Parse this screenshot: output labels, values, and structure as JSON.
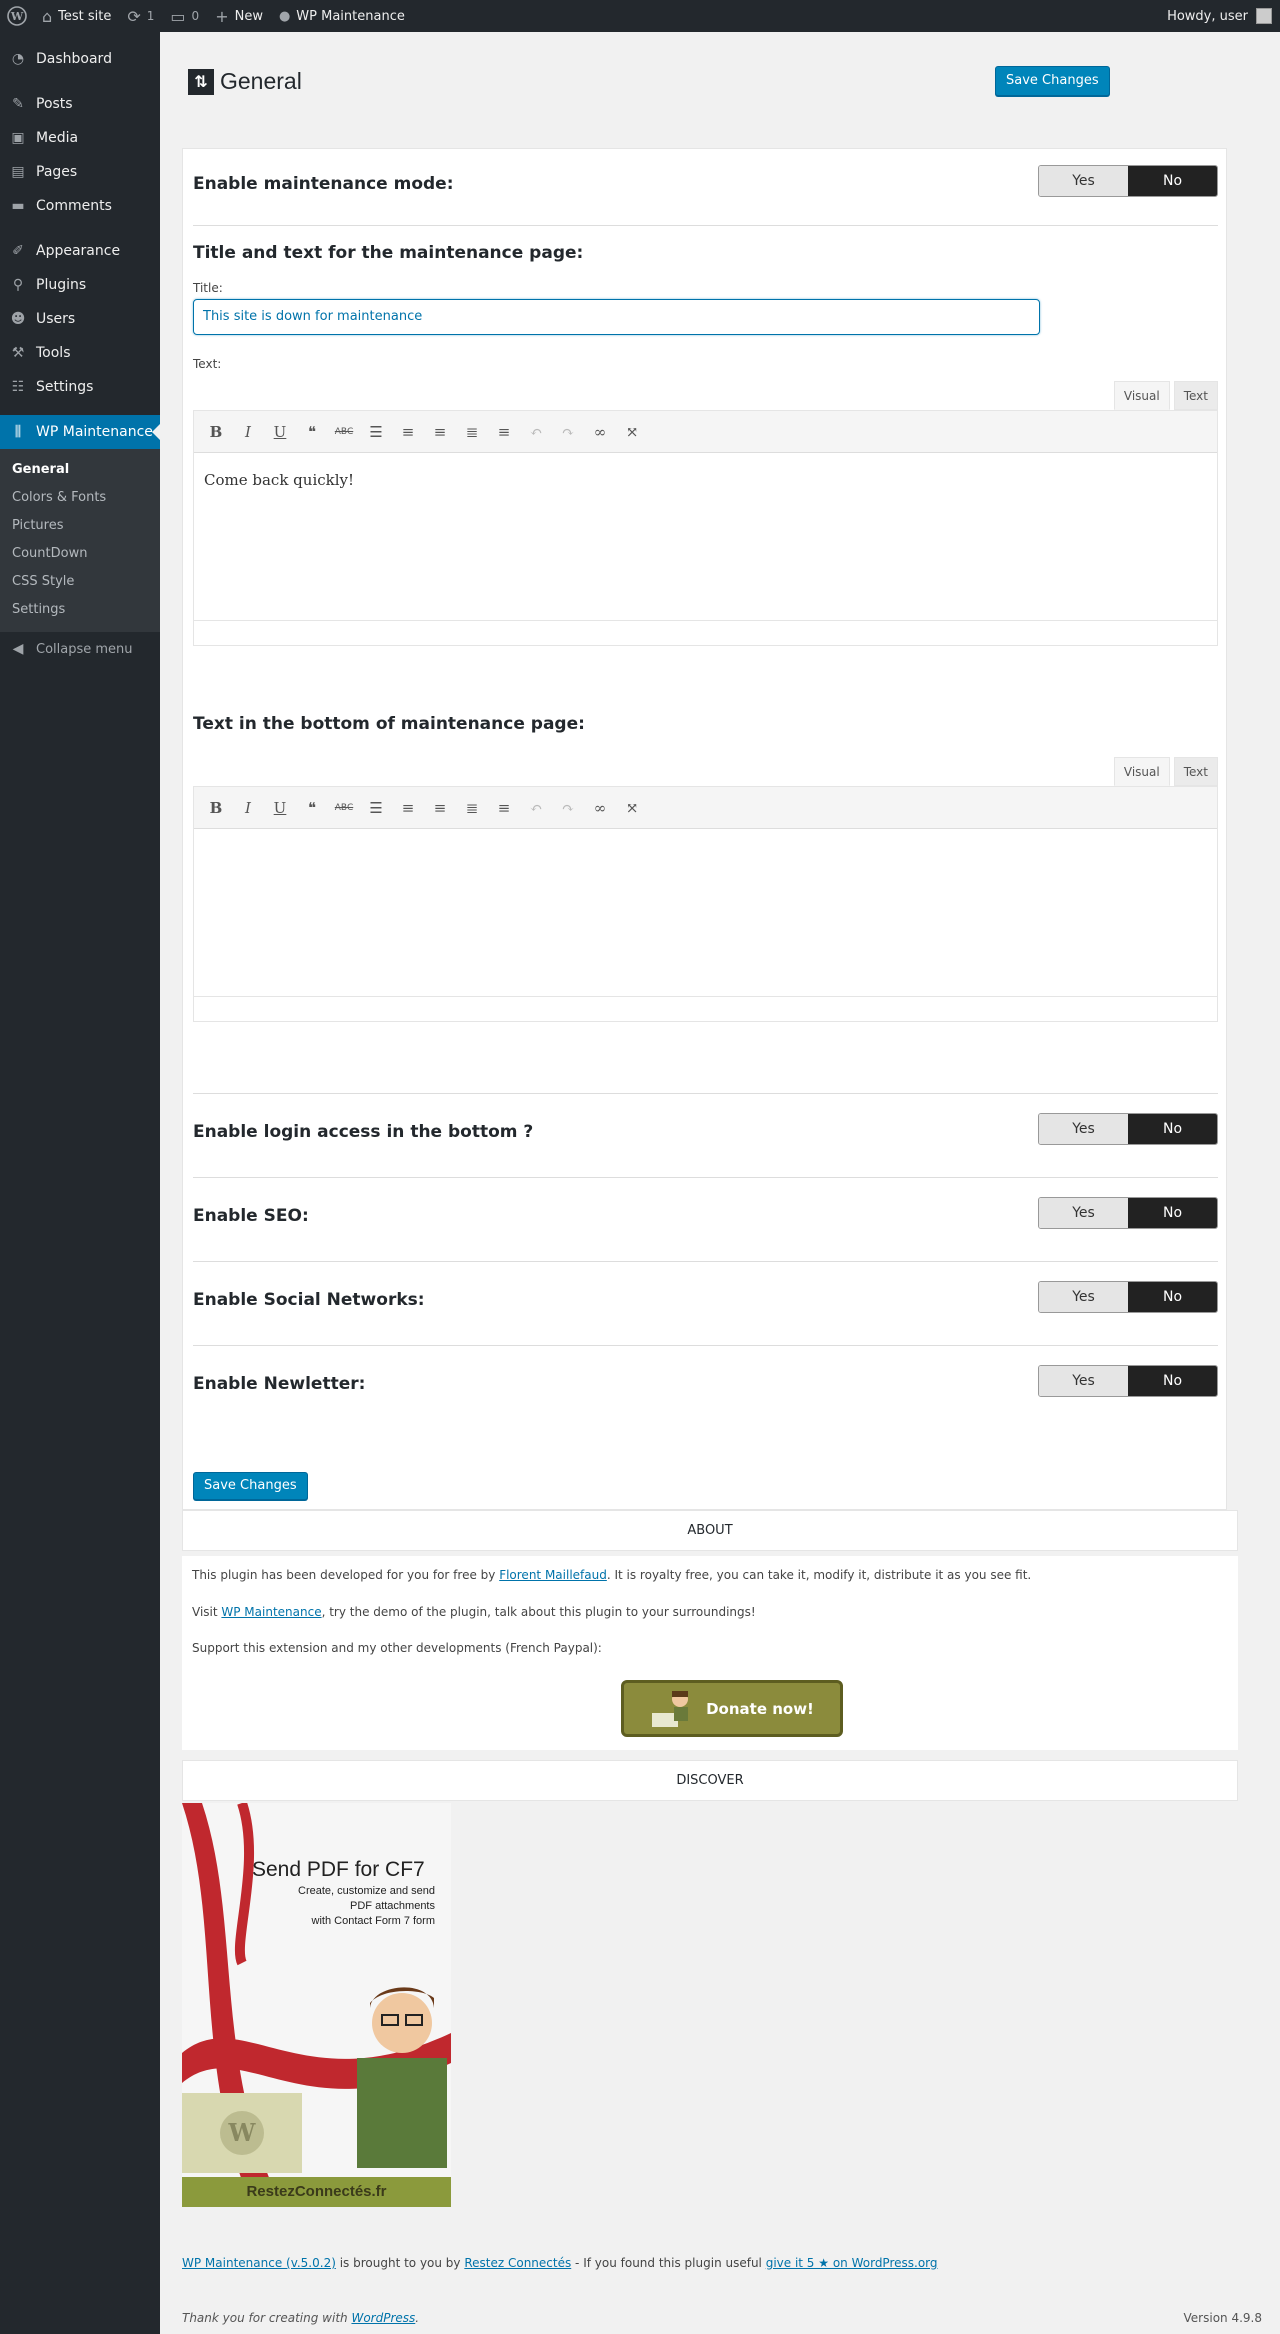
{
  "adminbar": {
    "site_name": "Test site",
    "updates_count": "1",
    "comments_count": "0",
    "new_label": "New",
    "plugin_label": "WP Maintenance",
    "howdy": "Howdy, user"
  },
  "sidebar": {
    "items": [
      {
        "label": "Dashboard",
        "icon": "dashboard-icon"
      },
      {
        "label": "Posts",
        "icon": "pin-icon"
      },
      {
        "label": "Media",
        "icon": "media-icon"
      },
      {
        "label": "Pages",
        "icon": "pages-icon"
      },
      {
        "label": "Comments",
        "icon": "comment-icon"
      },
      {
        "label": "Appearance",
        "icon": "brush-icon"
      },
      {
        "label": "Plugins",
        "icon": "plugin-icon"
      },
      {
        "label": "Users",
        "icon": "user-icon"
      },
      {
        "label": "Tools",
        "icon": "wrench-icon"
      },
      {
        "label": "Settings",
        "icon": "settings-icon"
      },
      {
        "label": "WP Maintenance",
        "icon": "sliders-icon"
      }
    ],
    "submenu": [
      "General",
      "Colors & Fonts",
      "Pictures",
      "CountDown",
      "CSS Style",
      "Settings"
    ],
    "collapse": "Collapse menu"
  },
  "page": {
    "title": "General",
    "save_label": "Save Changes"
  },
  "settings": {
    "maintenance_mode": "Enable maintenance mode:",
    "title_text_heading": "Title and text for the maintenance page:",
    "title_label": "Title:",
    "title_value": "This site is down for maintenance",
    "text_label": "Text:",
    "editor_tab_visual": "Visual",
    "editor_tab_text": "Text",
    "editor1_content": "Come back quickly!",
    "bottom_text_heading": "Text in the bottom of maintenance page:",
    "login_access": "Enable login access in the bottom ?",
    "seo": "Enable SEO:",
    "social": "Enable Social Networks:",
    "newsletter": "Enable Newletter:",
    "yes": "Yes",
    "no": "No"
  },
  "about": {
    "header": "ABOUT",
    "line1_pre": "This plugin has been developed for you for free by ",
    "line1_link": "Florent Maillefaud",
    "line1_post": ". It is royalty free, you can take it, modify it, distribute it as you see fit.",
    "line2_pre": "Visit ",
    "line2_link": "WP Maintenance",
    "line2_post": ", try the demo of the plugin, talk about this plugin to your surroundings!",
    "line3": "Support this extension and my other developments (French Paypal):",
    "donate": "Donate now!"
  },
  "discover": {
    "header": "DISCOVER",
    "promo_title": "Send PDF for CF7",
    "promo_sub1": "Create, customize and send",
    "promo_sub2": "PDF attachments",
    "promo_sub3": "with Contact Form 7 form",
    "promo_brand": "RestezConnectés.fr"
  },
  "footer": {
    "plugin_link": "WP Maintenance (v.5.0.2)",
    "brought": " is brought to you by ",
    "author_link": "Restez Connectés",
    "useful": " - If you found this plugin useful ",
    "rate_link": "give it 5 ★ on WordPress.org",
    "thanks_pre": "Thank you for creating with ",
    "thanks_link": "WordPress",
    "thanks_post": ".",
    "version": "Version 4.9.8"
  },
  "colors": {
    "accent": "#0073aa",
    "adminbar": "#23282d",
    "toggle_on": "#222222"
  }
}
